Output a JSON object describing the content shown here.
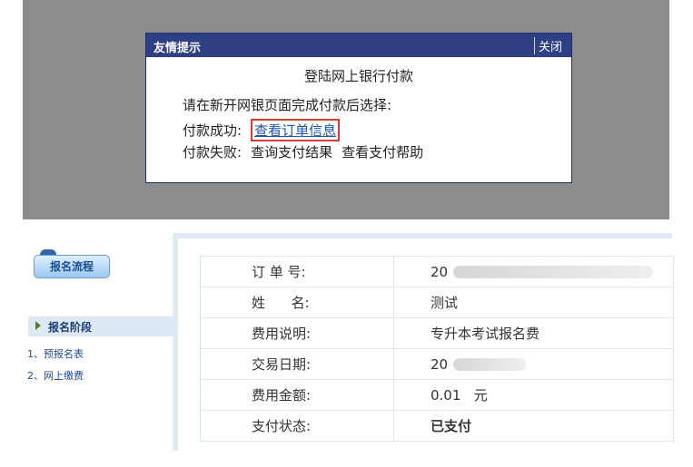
{
  "dialog": {
    "title": "友情提示",
    "close_label": "关闭",
    "heading": "登陆网上银行付款",
    "instruction": "请在新开网银页面完成付款后选择:",
    "success_label": "付款成功:",
    "success_link": "查看订单信息",
    "fail_label": "付款失败:",
    "fail_link_1": "查询支付结果",
    "fail_link_2": "查看支付帮助"
  },
  "sidebar": {
    "flow_button": "报名流程",
    "stage_label": "报名阶段",
    "steps": [
      "1、预报名表",
      "2、网上缴费"
    ]
  },
  "order": {
    "rows": [
      {
        "label": "订 单 号:",
        "value": "20"
      },
      {
        "label": "姓      名:",
        "value": "测试"
      },
      {
        "label": "费用说明:",
        "value": "专升本考试报名费"
      },
      {
        "label": "交易日期:",
        "value": "20"
      },
      {
        "label": "费用金额:",
        "value": "0.01   元"
      },
      {
        "label": "支付状态:",
        "value": "已支付"
      }
    ],
    "paid_color": "#1e9a2c"
  }
}
